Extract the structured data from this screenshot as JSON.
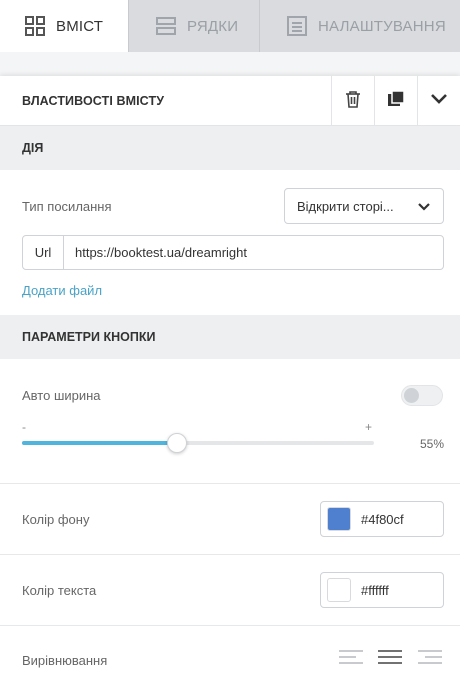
{
  "tabs": [
    {
      "label": "ВМІСТ",
      "icon": "grid-icon",
      "active": true
    },
    {
      "label": "РЯДКИ",
      "icon": "rows-icon",
      "active": false
    },
    {
      "label": "НАЛАШТУВАННЯ",
      "icon": "settings-list-icon",
      "active": false
    }
  ],
  "props": {
    "title": "ВЛАСТИВОСТІ ВМІСТУ"
  },
  "action": {
    "header": "ДІЯ",
    "link_type_label": "Тип посилання",
    "link_type_value": "Відкрити сторі...",
    "url_prefix": "Url",
    "url_value": "https://booktest.ua/dreamright",
    "add_file": "Додати файл"
  },
  "params": {
    "header": "ПАРАМЕТРИ КНОПКИ",
    "auto_width_label": "Авто ширина",
    "auto_width_on": false,
    "slider_min": "-",
    "slider_max": "+",
    "slider_value": "55%",
    "slider_fraction": 0.44,
    "bg_color_label": "Колір фону",
    "bg_color_value": "#4f80cf",
    "text_color_label": "Колір текста",
    "text_color_value": "#ffffff",
    "alignment_label": "Вирівнювання",
    "alignment_selected": "center"
  },
  "colors": {
    "accent": "#4fb5dc",
    "link": "#4aa3c7",
    "tab_bg": "#d9dbde",
    "section_bg": "#eeeff0"
  }
}
